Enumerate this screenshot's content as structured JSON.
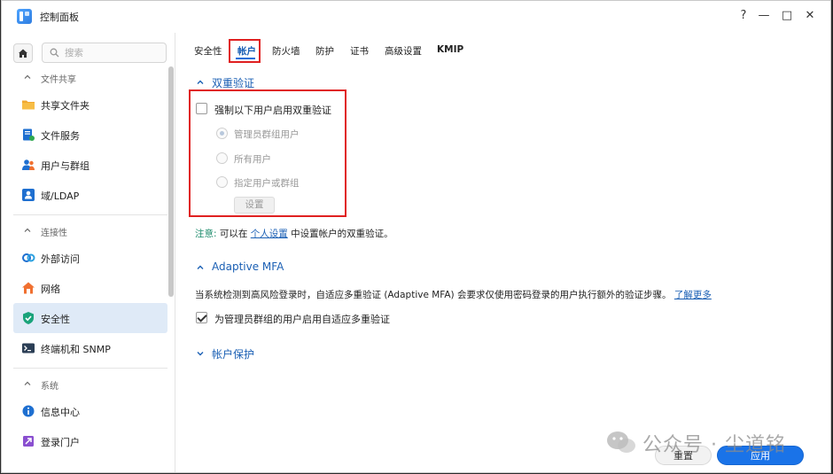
{
  "window": {
    "title": "控制面板"
  },
  "titlebar_buttons": {
    "help": "?",
    "minimize": "—",
    "maximize": "□",
    "close": "✕"
  },
  "sidebar": {
    "search_placeholder": "搜索",
    "sections": [
      {
        "label": "文件共享",
        "items": [
          "共享文件夹",
          "文件服务",
          "用户与群组",
          "域/LDAP"
        ]
      },
      {
        "label": "连接性",
        "items": [
          "外部访问",
          "网络",
          "安全性",
          "终端机和 SNMP"
        ]
      },
      {
        "label": "系统",
        "items": [
          "信息中心",
          "登录门户"
        ]
      }
    ],
    "active_item": "安全性"
  },
  "tabs": [
    "安全性",
    "帐户",
    "防火墙",
    "防护",
    "证书",
    "高级设置",
    "KMIP"
  ],
  "active_tab": "帐户",
  "two_factor": {
    "title": "双重验证",
    "enforce_label": "强制以下用户启用双重验证",
    "options": [
      "管理员群组用户",
      "所有用户",
      "指定用户或群组"
    ],
    "settings_button": "设置",
    "note_prefix": "注意:",
    "note_mid": "可以在",
    "note_link": "个人设置",
    "note_suffix": "中设置帐户的双重验证。"
  },
  "adaptive_mfa": {
    "title": "Adaptive MFA",
    "description": "当系统检测到高风险登录时，自适应多重验证 (Adaptive MFA) 会要求仅使用密码登录的用户执行额外的验证步骤。",
    "learn_more": "了解更多",
    "checkbox_label": "为管理员群组的用户启用自适应多重验证",
    "checked": true
  },
  "account_protection": {
    "title": "帐户保护"
  },
  "footer": {
    "reset": "重置",
    "apply": "应用"
  },
  "watermark": {
    "text": "公众号 · 尘道铭"
  },
  "colors": {
    "accent": "#1a73e8",
    "highlight_box": "#e02020",
    "active_bg": "#dfeaf7"
  }
}
